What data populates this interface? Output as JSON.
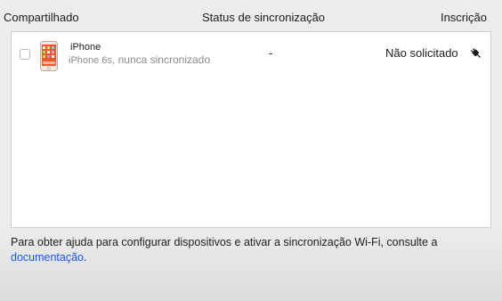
{
  "table": {
    "headers": {
      "shared": "Compartilhado",
      "sync_status": "Status de sincronização",
      "enrollment": "Inscrição"
    },
    "rows": [
      {
        "name": "iPhone",
        "model": "iPhone 6s",
        "detail": ", nunca sincronizado",
        "sync_status": "-",
        "enrollment": "Não solicitado",
        "icon": "iphone-icon"
      }
    ]
  },
  "footer": {
    "help_prefix": "Para obter ajuda para configurar dispositivos e ativar a sincronização Wi-Fi, consulte a ",
    "link_text": "documentação",
    "help_suffix": "."
  },
  "colors": {
    "link": "#1a56e8",
    "background": "#ececec",
    "panel": "#ffffff"
  }
}
